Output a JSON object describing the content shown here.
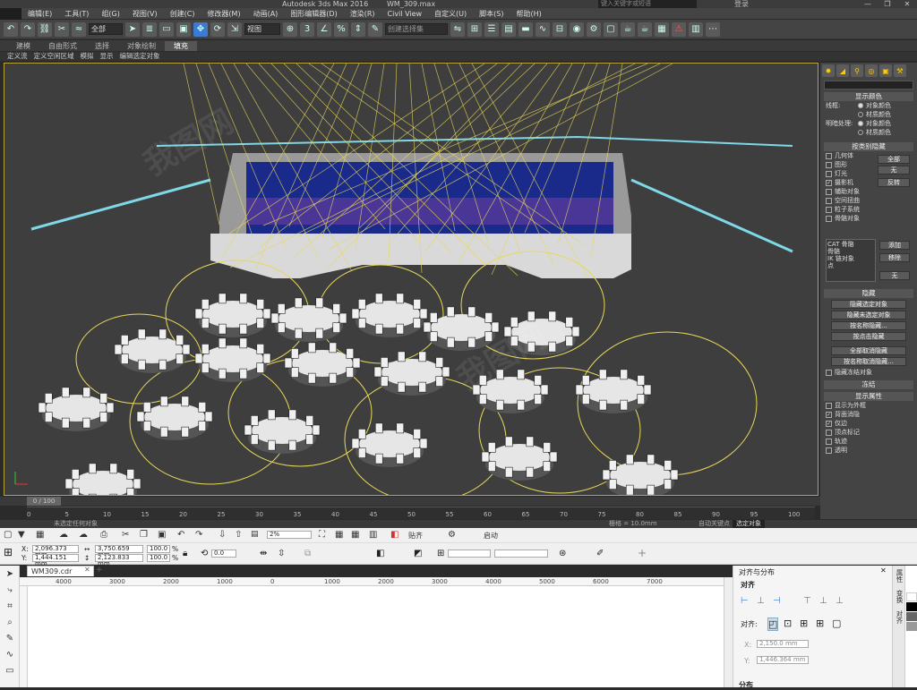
{
  "app_logo": "MAX",
  "title": {
    "app": "Autodesk 3ds Max 2016",
    "file": "WM_309.max",
    "search_placeholder": "键入关键字或短语",
    "sign_in": "登录",
    "controls": [
      "—",
      "❐",
      "✕"
    ]
  },
  "menu": [
    "编辑(E)",
    "工具(T)",
    "组(G)",
    "视图(V)",
    "创建(C)",
    "修改器(M)",
    "动画(A)",
    "图形编辑器(D)",
    "渲染(R)",
    "Civil View",
    "自定义(U)",
    "脚本(S)",
    "帮助(H)"
  ],
  "toolbar": {
    "filter_value": "全部",
    "ref_coord_value": "视图",
    "selection_set_placeholder": "创建选择集",
    "icons": [
      "undo-icon",
      "redo-icon",
      "link-icon",
      "unlink-icon",
      "bind-icon",
      "select-icon",
      "select-name-icon",
      "rect-select-icon",
      "window-cross-icon",
      "move-icon",
      "rotate-icon",
      "scale-icon",
      "pivot-icon",
      "snap-icon",
      "angle-snap-icon",
      "percent-snap-icon",
      "spinner-snap-icon",
      "mirror-icon",
      "align-icon",
      "layer-icon",
      "curve-editor-icon",
      "schematic-icon",
      "material-editor-icon",
      "render-setup-icon",
      "render-frame-icon",
      "render-icon"
    ]
  },
  "ribbon": {
    "tabs": [
      "建模",
      "自由形式",
      "选择",
      "对象绘制",
      "填充"
    ],
    "active_tab": "填充",
    "sub": [
      "定义流",
      "定义空闲区域",
      "模拟",
      "显示",
      "编辑选定对象"
    ]
  },
  "command_panel": {
    "display_color": {
      "title": "显示颜色",
      "wireframe_label": "线框:",
      "shaded_label": "明暗处理:",
      "opt_object": "对象颜色",
      "opt_material": "材质颜色"
    },
    "hide_by_category": {
      "title": "按类别隐藏",
      "items": [
        {
          "label": "几何体",
          "checked": false
        },
        {
          "label": "图形",
          "checked": false
        },
        {
          "label": "灯光",
          "checked": false
        },
        {
          "label": "摄影机",
          "checked": true
        },
        {
          "label": "辅助对象",
          "checked": false
        },
        {
          "label": "空间扭曲",
          "checked": false
        },
        {
          "label": "粒子系统",
          "checked": false
        },
        {
          "label": "骨骼对象",
          "checked": false
        }
      ],
      "btn_all": "全部",
      "btn_none": "无",
      "btn_invert": "反转",
      "list": [
        "CAT 骨骼",
        "骨骼",
        "IK 链对象",
        "点"
      ],
      "btn_add": "添加",
      "btn_remove": "移除",
      "btn_none2": "无"
    },
    "hide": {
      "title": "隐藏",
      "buttons": [
        "隐藏选定对象",
        "隐藏未选定对象",
        "按名称隐藏...",
        "按点击隐藏",
        "全部取消隐藏",
        "按名称取消隐藏..."
      ],
      "frozen_label": "隐藏冻结对象"
    },
    "freeze_title": "冻结",
    "display_props": {
      "title": "显示属性",
      "items": [
        {
          "label": "显示为外框",
          "checked": false
        },
        {
          "label": "背面消隐",
          "checked": true
        },
        {
          "label": "仅边",
          "checked": true
        },
        {
          "label": "顶点标记",
          "checked": false
        },
        {
          "label": "轨迹",
          "checked": false
        },
        {
          "label": "透明",
          "checked": false
        }
      ]
    }
  },
  "timeline": {
    "frame": "0 / 100",
    "ticks": [
      "0",
      "5",
      "10",
      "15",
      "20",
      "25",
      "30",
      "35",
      "40",
      "45",
      "50",
      "55",
      "60",
      "65",
      "70",
      "75",
      "80",
      "85",
      "90",
      "95",
      "100"
    ]
  },
  "status": {
    "selection": "未选定任何对象",
    "grid": "栅格 = 10.0mm",
    "auto_key": "自动关键点",
    "set_key_filter": "选定对象"
  },
  "corel": {
    "zoom": "2%",
    "snap_label": "贴齐",
    "launch_label": "启动",
    "x_value": "2,096.373 mm",
    "y_value": "1,444.151 mm",
    "w_value": "3,750.659 mm",
    "h_value": "2,123.833 mm",
    "sx": "100.0",
    "sy": "100.0",
    "pct": "%",
    "angle": "0.0",
    "doc_tab": "WM309.cdr",
    "ruler_ticks": [
      "4000",
      "3000",
      "2000",
      "1000",
      "0",
      "1000",
      "2000",
      "3000",
      "4000",
      "5000",
      "6000",
      "7000"
    ],
    "docker": {
      "title": "对齐与分布",
      "align_section": "对齐",
      "align_to": "对齐:",
      "x_label": "X:",
      "x_value": "2,150.0 mm",
      "y_label": "Y:",
      "y_value": "1,446.364 mm",
      "distribute_section": "分布"
    },
    "side_tabs": [
      "属性",
      "变换",
      "对齐"
    ]
  },
  "viewport_colors": {
    "floor": "#3e3e3e",
    "stage": "#d9d9d9",
    "screen": "#1a2a8a",
    "light_beam": "#e8d85a",
    "truss": "#7fd8e8",
    "frame_border": "#b8a23a"
  },
  "watermark": "我图网"
}
